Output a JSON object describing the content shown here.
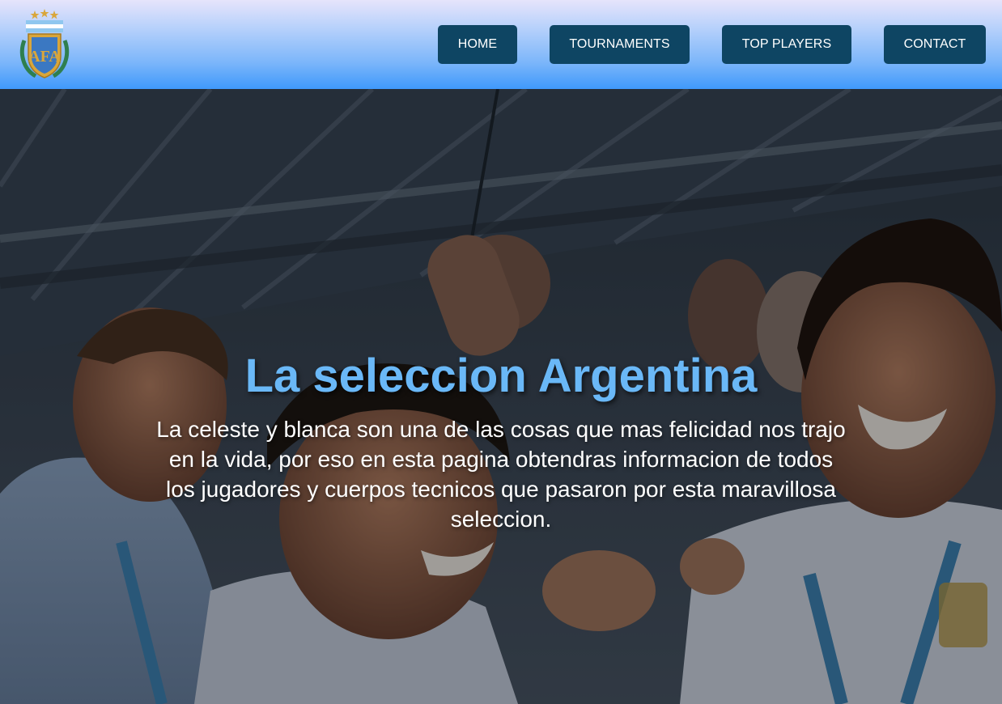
{
  "header": {
    "logo": {
      "icon": "afa-crest-icon",
      "text": "AFA"
    },
    "nav": [
      {
        "label": "HOME"
      },
      {
        "label": "TOURNAMENTS"
      },
      {
        "label": "TOP PLAYERS"
      },
      {
        "label": "CONTACT"
      }
    ],
    "colors": {
      "nav_button_bg": "#0e4563",
      "gradient_top": "#e6e4fb",
      "gradient_bottom": "#3f99fb"
    }
  },
  "hero": {
    "title": "La seleccion Argentina",
    "description": "La celeste y blanca son una de las cosas que mas felicidad nos trajo en la vida, por eso en esta pagina obtendras informacion de todos los jugadores y cuerpos tecnicos que pasaron por esta maravillosa seleccion.",
    "colors": {
      "title": "#6ab8f7",
      "text": "#ffffff"
    }
  }
}
